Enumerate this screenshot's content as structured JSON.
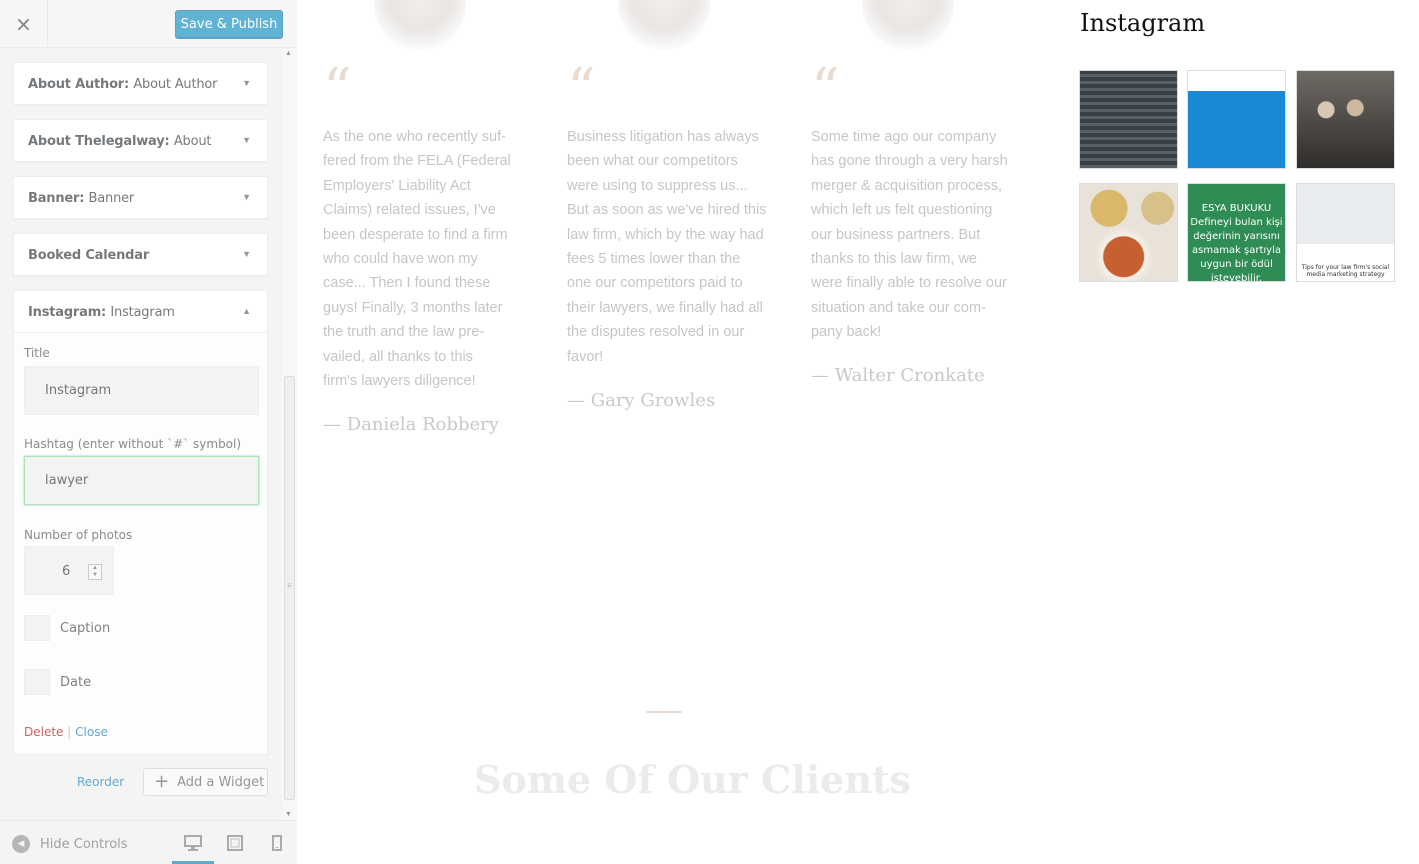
{
  "toolbar": {
    "close_icon": "×",
    "save_label": "Save & Publish"
  },
  "widgets": [
    {
      "name": "About Author:",
      "subtitle": "About Author"
    },
    {
      "name": "About Thelegalway:",
      "subtitle": "About"
    },
    {
      "name": "Banner:",
      "subtitle": "Banner"
    },
    {
      "name": "Booked Calendar",
      "subtitle": ""
    },
    {
      "name": "Instagram:",
      "subtitle": "Instagram"
    }
  ],
  "instagram_form": {
    "title_label": "Title",
    "title_value": "Instagram",
    "hashtag_label": "Hashtag (enter without `#` symbol)",
    "hashtag_value": "lawyer",
    "photos_label": "Number of photos",
    "photos_value": "6",
    "caption_label": "Caption",
    "date_label": "Date",
    "delete_label": "Delete",
    "separator": "|",
    "close_label": "Close"
  },
  "footer_actions": {
    "reorder_label": "Reorder",
    "add_widget_label": "Add a Widget",
    "add_icon": "+"
  },
  "footer": {
    "hide_controls_label": "Hide Controls"
  },
  "icons": {
    "collapse_arrow": "▼",
    "expand_arrow": "▲",
    "scroll_up": "▲",
    "scroll_down": "▼",
    "grip": "≡",
    "spinner_up": "▲",
    "spinner_down": "▼",
    "hide_controls": "◀"
  },
  "testimonials": [
    {
      "quote_mark": "“",
      "text": "As the one who recently suf-fered from the FELA (Federal Employers' Liability Act Claims) related issues, I've been desperate to find a firm who could have won my case... Then I found these guys! Finally, 3 months later the truth and the law pre-vailed, all thanks to this firm's lawyers diligence!",
      "author": "— Daniela Robbery"
    },
    {
      "quote_mark": "“",
      "text": "Business litigation has always been what our competitors were using to suppress us... But as soon as we've hired this law firm, which by the way had fees 5 times lower than the one our competitors paid to their lawyers, we finally had all the disputes resolved in our favor!",
      "author": "— Gary Growles"
    },
    {
      "quote_mark": "“",
      "text": "Some time ago our company has gone through a very harsh merger & acquisition process, which left us felt questioning our business partners. But thanks to this law firm, we were finally able to resolve our situation and take our com-pany back!",
      "author": "— Walter Cronkate"
    }
  ],
  "instagram_preview": {
    "title": "Instagram",
    "photo5_text": "ESYA BUKUKU Defineyi bulan kişi değerinin yarısını asmamak şartıyla uygun bir ödül isteyebilir.",
    "photo6_text": "Tips for your law firm's social media marketing strategy"
  },
  "clients": {
    "title": "Some Of Our Clients"
  },
  "colors": {
    "accent": "#0085ba",
    "link": "#0073aa",
    "delete": "#a00000",
    "focus": "#7ad08a",
    "quote": "#eadbd1"
  }
}
